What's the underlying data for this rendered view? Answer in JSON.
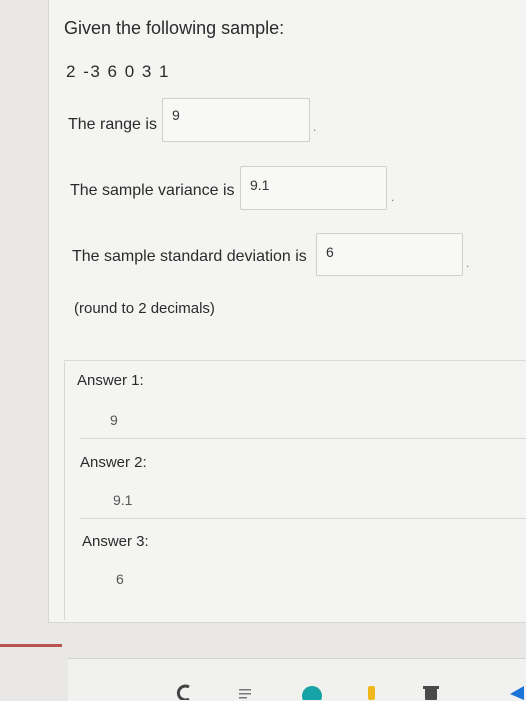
{
  "question": {
    "prompt": "Given the following sample:",
    "sample": "2 -3 6 0 3 1",
    "range_label": "The range is",
    "range_value": "9",
    "variance_label": "The sample variance is",
    "variance_value": "9.1",
    "std_label": "The sample standard deviation is",
    "std_value": "6",
    "period": ".",
    "note": "(round to 2 decimals)"
  },
  "answers": [
    {
      "label": "Answer 1:",
      "value": "9"
    },
    {
      "label": "Answer 2:",
      "value": "9.1"
    },
    {
      "label": "Answer 3:",
      "value": "6"
    }
  ],
  "icons": {
    "dock": [
      "app-icon-c",
      "app-icon-list",
      "app-icon-teal",
      "app-icon-yellow",
      "app-icon-bin",
      "app-icon-blue"
    ]
  }
}
